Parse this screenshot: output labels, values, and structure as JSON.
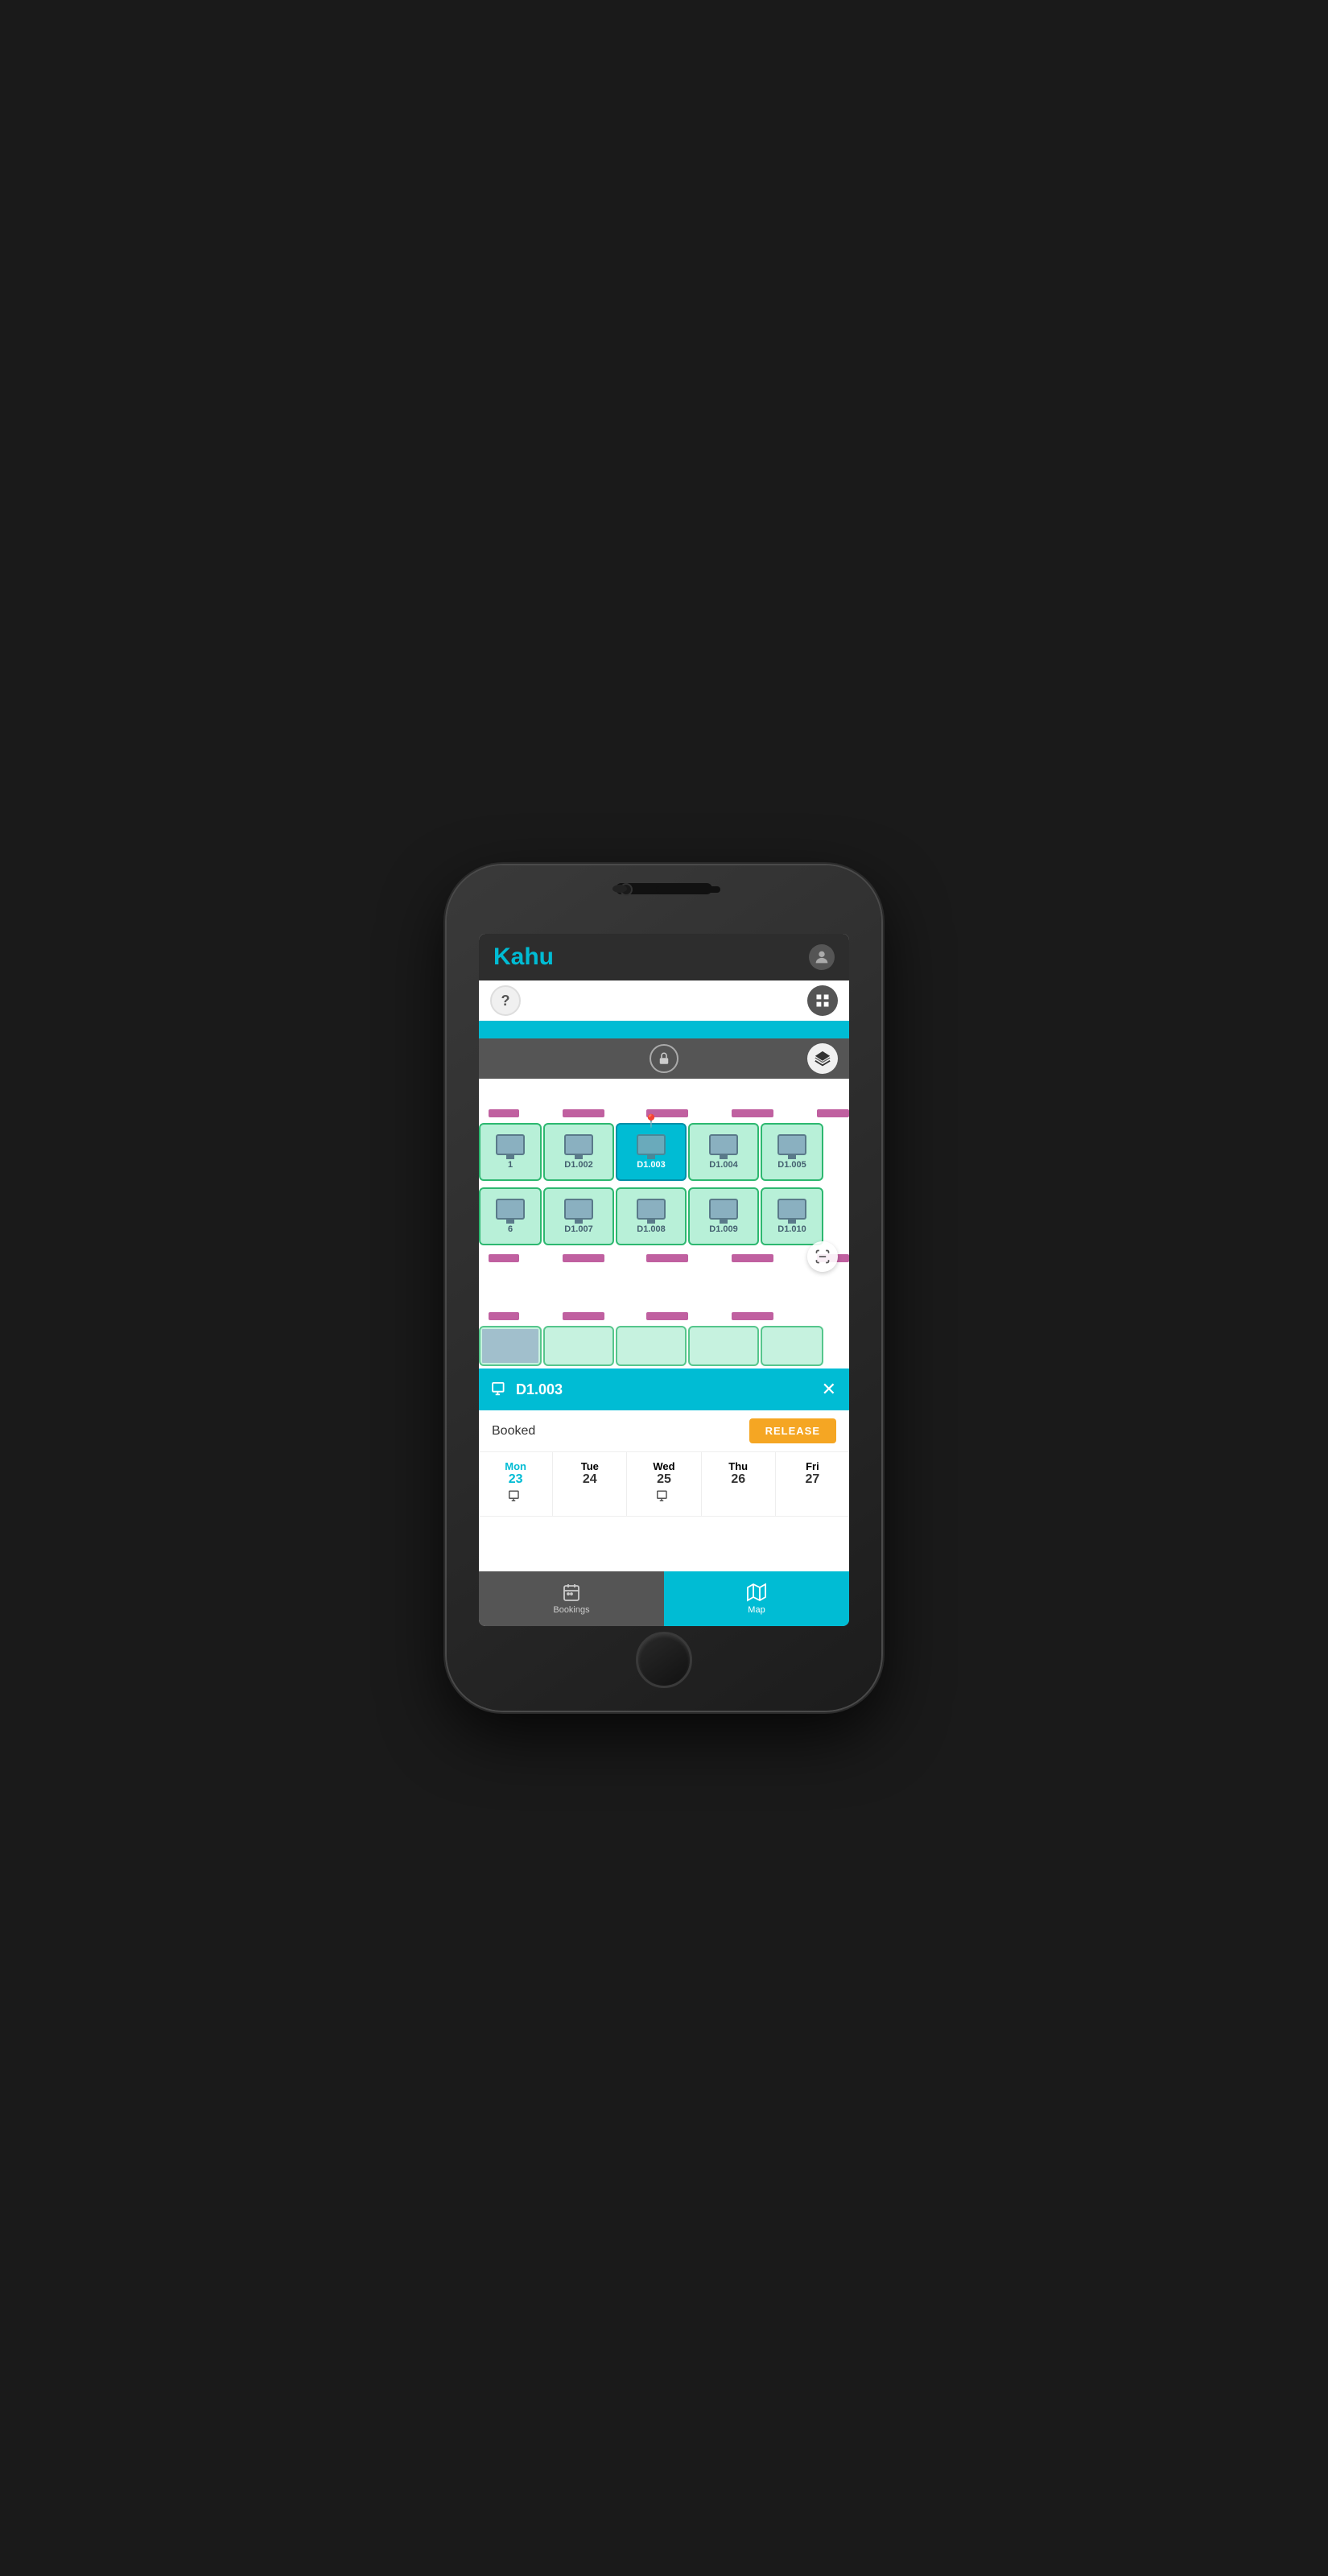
{
  "app": {
    "title": "Kahu",
    "header": {
      "title": "Kahu"
    }
  },
  "toolbar": {
    "help_label": "?",
    "grid_label": "⊞",
    "lock_label": "🔒",
    "layers_label": "◈",
    "scan_label": "⊙"
  },
  "map": {
    "desks": [
      {
        "id": "D1.001",
        "label": "1",
        "state": "available",
        "row": 0,
        "col": 0
      },
      {
        "id": "D1.002",
        "label": "D1.002",
        "state": "available",
        "row": 0,
        "col": 1
      },
      {
        "id": "D1.003",
        "label": "D1.003",
        "state": "selected",
        "row": 0,
        "col": 2
      },
      {
        "id": "D1.004",
        "label": "D1.004",
        "state": "available",
        "row": 0,
        "col": 3
      },
      {
        "id": "D1.005",
        "label": "D1.005",
        "state": "available",
        "row": 0,
        "col": 4
      },
      {
        "id": "D1.006",
        "label": "6",
        "state": "available",
        "row": 1,
        "col": 0
      },
      {
        "id": "D1.007",
        "label": "D1.007",
        "state": "available",
        "row": 1,
        "col": 1
      },
      {
        "id": "D1.008",
        "label": "D1.008",
        "state": "available",
        "row": 1,
        "col": 2
      },
      {
        "id": "D1.009",
        "label": "D1.009",
        "state": "available",
        "row": 1,
        "col": 3
      },
      {
        "id": "D1.010",
        "label": "D1.010",
        "state": "available",
        "row": 1,
        "col": 4
      }
    ]
  },
  "desk_panel": {
    "icon": "🖥",
    "name": "D1.003",
    "close_label": "✕",
    "status": "Booked",
    "release_label": "RELEASE"
  },
  "calendar": {
    "days": [
      {
        "name": "Mon",
        "num": "23",
        "active": true,
        "has_booking": true
      },
      {
        "name": "Tue",
        "num": "24",
        "active": false,
        "has_booking": false
      },
      {
        "name": "Wed",
        "num": "25",
        "active": false,
        "has_booking": true
      },
      {
        "name": "Thu",
        "num": "26",
        "active": false,
        "has_booking": false
      },
      {
        "name": "Fri",
        "num": "27",
        "active": false,
        "has_booking": false
      }
    ]
  },
  "bottom_nav": {
    "items": [
      {
        "id": "bookings",
        "label": "Bookings",
        "icon": "📅",
        "active": false
      },
      {
        "id": "map",
        "label": "Map",
        "icon": "🗺",
        "active": true
      }
    ]
  }
}
